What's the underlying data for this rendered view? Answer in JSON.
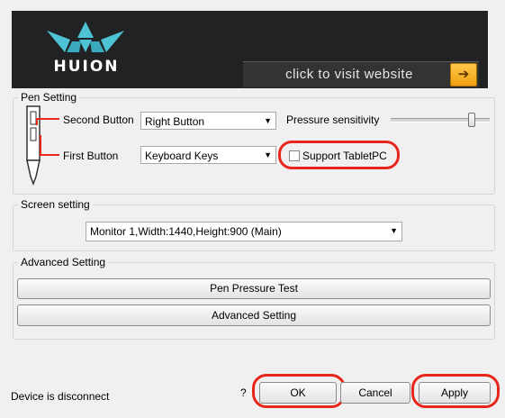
{
  "banner": {
    "brand": "HUION",
    "visit_label": "click to visit website",
    "arrow_glyph": "➔"
  },
  "pen_setting": {
    "title": "Pen Setting",
    "second_button_label": "Second Button",
    "second_button_value": "Right Button",
    "first_button_label": "First Button",
    "first_button_value": "Keyboard Keys",
    "pressure_label": "Pressure sensitivity",
    "pressure_level": 0.88,
    "support_tabletpc_label": "Support TabletPC",
    "support_tabletpc_checked": false
  },
  "screen_setting": {
    "title": "Screen setting",
    "monitor_value": "Monitor 1,Width:1440,Height:900 (Main)"
  },
  "advanced_setting": {
    "title": "Advanced Setting",
    "pen_pressure_test_label": "Pen Pressure Test",
    "advanced_setting_label": "Advanced Setting"
  },
  "footer": {
    "status": "Device is disconnect",
    "help": "?",
    "ok_label": "OK",
    "cancel_label": "Cancel",
    "apply_label": "Apply"
  },
  "colors": {
    "highlight_ring": "#e8261c",
    "banner_bg": "#212224",
    "logo_teal": "#4ec3d6",
    "arrow_orange": "#f0a010"
  },
  "icons": [
    "huion-crown-icon",
    "arrow-right-icon",
    "dropdown-arrow-icon",
    "pen-diagram-icon"
  ]
}
